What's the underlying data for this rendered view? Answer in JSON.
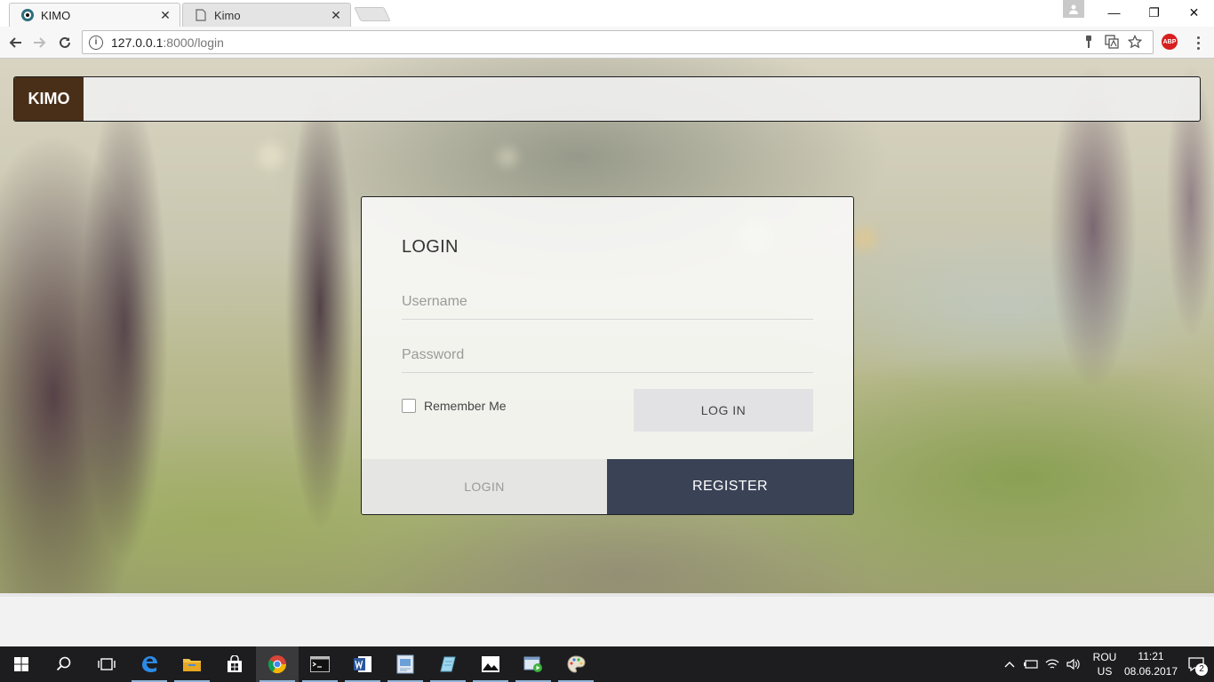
{
  "browser": {
    "tabs": [
      {
        "title": "KIMO",
        "active": true
      },
      {
        "title": "Kimo",
        "active": false
      }
    ],
    "close_glyph": "✕",
    "url_host": "127.0.0.1",
    "url_path": ":8000/login",
    "window_controls": {
      "minimize": "—",
      "restore": "❐",
      "close": "✕"
    },
    "extension_label": "ABP",
    "icons": [
      "back-icon",
      "forward-icon",
      "reload-icon",
      "info-icon",
      "key-icon",
      "translate-icon",
      "star-icon",
      "adblock-icon",
      "menu-icon"
    ]
  },
  "site": {
    "brand": "KIMO"
  },
  "login_card": {
    "title": "LOGIN",
    "username_placeholder": "Username",
    "password_placeholder": "Password",
    "remember_label": "Remember Me",
    "remember_checked": false,
    "login_button": "LOG IN",
    "tab_login": "LOGIN",
    "tab_register": "REGISTER"
  },
  "colors": {
    "brand_bg": "#4a2f18",
    "register_bg": "#3a4256",
    "login_button_bg": "#e2e2e4"
  },
  "taskbar": {
    "apps": [
      "start-icon",
      "search-icon",
      "task-view-icon",
      "edge-icon",
      "file-explorer-icon",
      "store-icon",
      "chrome-icon",
      "cmd-icon",
      "word-icon",
      "paint-icon",
      "notepad-icon",
      "photos-icon",
      "media-icon",
      "paint-3d-icon"
    ],
    "language_top": "ROU",
    "language_bottom": "US",
    "time": "11:21",
    "date": "08.06.2017",
    "notifications_count": "2"
  }
}
